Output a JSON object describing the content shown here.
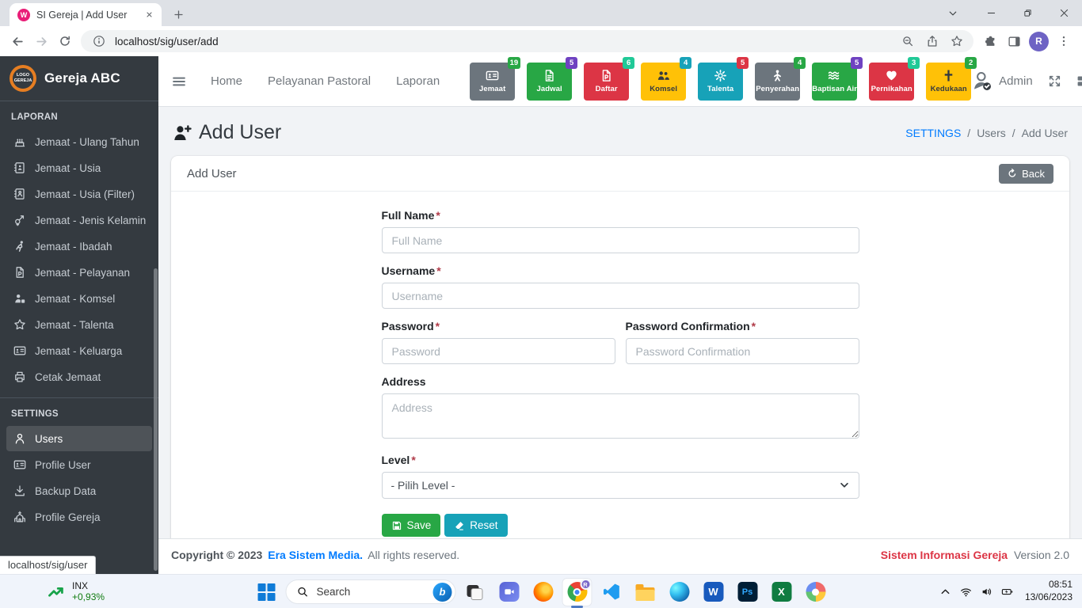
{
  "browser": {
    "tab_title": "SI Gereja | Add User",
    "favicon_letter": "W",
    "url": "localhost/sig/user/add",
    "profile_letter": "R"
  },
  "navbar": {
    "links": [
      "Home",
      "Pelayanan Pastoral",
      "Laporan"
    ],
    "tiles": [
      {
        "label": "Jemaat",
        "badge": "19",
        "icon": "id-card",
        "color": "#6c757d",
        "text_color": "#ffffff",
        "badge_color": "#28a745"
      },
      {
        "label": "Jadwal",
        "badge": "5",
        "icon": "file-doc",
        "color": "#28a745",
        "text_color": "#ffffff",
        "badge_color": "#6f42c1"
      },
      {
        "label": "Daftar",
        "badge": "6",
        "icon": "file-p",
        "color": "#dc3545",
        "text_color": "#ffffff",
        "badge_color": "#20c997"
      },
      {
        "label": "Komsel",
        "badge": "4",
        "icon": "users",
        "color": "#ffc107",
        "text_color": "#343a40",
        "badge_color": "#17a2b8"
      },
      {
        "label": "Talenta",
        "badge": "5",
        "icon": "cog",
        "color": "#17a2b8",
        "text_color": "#ffffff",
        "badge_color": "#dc3545"
      },
      {
        "label": "Penyerahan",
        "badge": "4",
        "icon": "child",
        "color": "#6c757d",
        "text_color": "#ffffff",
        "badge_color": "#28a745"
      },
      {
        "label": "Baptisan Air",
        "badge": "5",
        "icon": "water",
        "color": "#28a745",
        "text_color": "#ffffff",
        "badge_color": "#6f42c1"
      },
      {
        "label": "Pernikahan",
        "badge": "3",
        "icon": "heart",
        "color": "#dc3545",
        "text_color": "#ffffff",
        "badge_color": "#20c997"
      },
      {
        "label": "Kedukaan",
        "badge": "2",
        "icon": "cross",
        "color": "#ffc107",
        "text_color": "#343a40",
        "badge_color": "#28a745"
      }
    ],
    "user_name": "Admin"
  },
  "sidebar": {
    "logo_text": "LOGO GEREJA",
    "brand": "Gereja ABC",
    "sections": [
      {
        "title": "LAPORAN",
        "items": [
          {
            "label": "Jemaat - Ulang Tahun",
            "icon": "cake"
          },
          {
            "label": "Jemaat - Usia",
            "icon": "book"
          },
          {
            "label": "Jemaat - Usia (Filter)",
            "icon": "book-open"
          },
          {
            "label": "Jemaat - Jenis Kelamin",
            "icon": "gender"
          },
          {
            "label": "Jemaat - Ibadah",
            "icon": "pray"
          },
          {
            "label": "Jemaat - Pelayanan",
            "icon": "file-p"
          },
          {
            "label": "Jemaat - Komsel",
            "icon": "user-tag"
          },
          {
            "label": "Jemaat - Talenta",
            "icon": "star"
          },
          {
            "label": "Jemaat - Keluarga",
            "icon": "id-card"
          },
          {
            "label": "Cetak Jemaat",
            "icon": "print"
          }
        ]
      },
      {
        "title": "SETTINGS",
        "items": [
          {
            "label": "Users",
            "icon": "user",
            "active": true
          },
          {
            "label": "Profile User",
            "icon": "id-card"
          },
          {
            "label": "Backup Data",
            "icon": "download"
          },
          {
            "label": "Profile Gereja",
            "icon": "church"
          }
        ]
      }
    ]
  },
  "page": {
    "title": "Add User",
    "breadcrumb": {
      "root": "SETTINGS",
      "middle": "Users",
      "current": "Add User",
      "separator": "/"
    },
    "card": {
      "title": "Add User",
      "back_label": "Back",
      "form": {
        "required_marker": "*",
        "full_name": {
          "label": "Full Name",
          "placeholder": "Full Name"
        },
        "username": {
          "label": "Username",
          "placeholder": "Username"
        },
        "password": {
          "label": "Password",
          "placeholder": "Password"
        },
        "password_confirmation": {
          "label": "Password Confirmation",
          "placeholder": "Password Confirmation"
        },
        "address": {
          "label": "Address",
          "placeholder": "Address"
        },
        "level": {
          "label": "Level",
          "selected": "- Pilih Level -"
        },
        "save_label": "Save",
        "reset_label": "Reset"
      }
    }
  },
  "footer": {
    "copyright_prefix": "Copyright © 2023",
    "company": "Era Sistem Media.",
    "rights": "All rights reserved.",
    "app_name": "Sistem Informasi Gereja",
    "version": "Version 2.0"
  },
  "statusbar": {
    "text": "localhost/sig/user"
  },
  "taskbar": {
    "widget": {
      "symbol": "INX",
      "change": "+0,93%"
    },
    "search_placeholder": "Search",
    "clock": {
      "time": "08:51",
      "date": "13/06/2023"
    },
    "app_letters": {
      "word": "W",
      "photoshop": "Ps",
      "excel": "X",
      "bing": "b",
      "chrome_badge": "R"
    }
  },
  "colors": {
    "sidebar_bg": "#343a40",
    "link_blue": "#007bff",
    "save_green": "#28a745",
    "reset_teal": "#17a2b8",
    "back_gray": "#6c757d",
    "footer_brand_red": "#dc3545",
    "logo_orange": "#e67e22"
  }
}
